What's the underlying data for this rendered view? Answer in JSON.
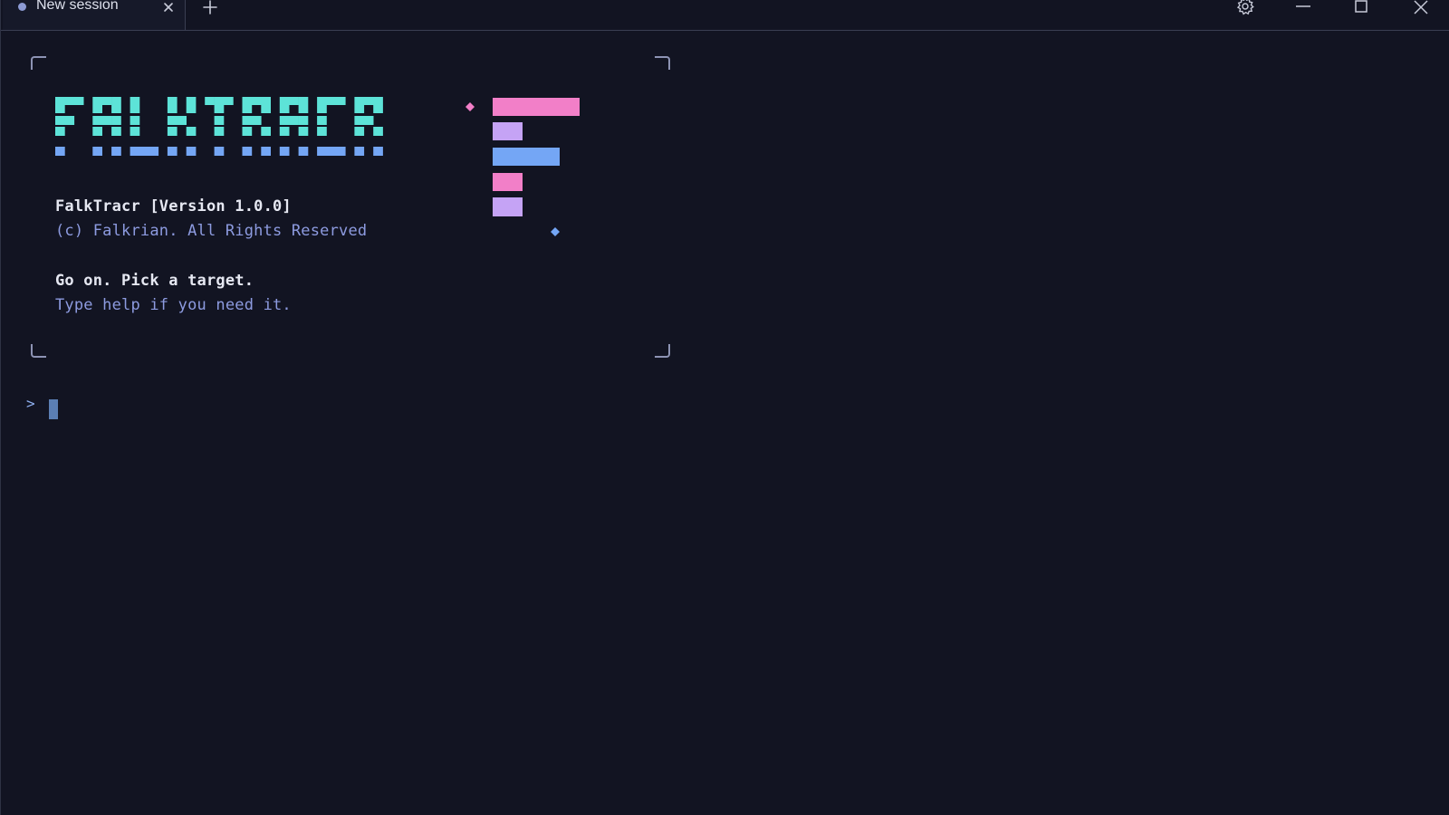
{
  "tab": {
    "label": "New session",
    "dot_icon": "status-dot-icon",
    "close_icon": "close-icon"
  },
  "titlebar": {
    "new_tab_icon": "plus-icon",
    "settings_icon": "gear-icon",
    "minimize_icon": "minimize-icon",
    "maximize_icon": "maximize-icon",
    "close_icon": "close-icon"
  },
  "banner": {
    "logo_text": "FALKTRACR",
    "version_line": "FalkTracr [Version 1.0.0]",
    "copyright_line": "(c) Falkrian. All Rights Reserved",
    "prompt_line": "Go on. Pick a target.",
    "hint_line": "Type help if you need it."
  },
  "input": {
    "prompt_symbol": ">",
    "value": ""
  },
  "colors": {
    "background": "#121422",
    "logo_teal": "#5de3d8",
    "logo_blue": "#74a6f5",
    "accent_pink": "#f27fc8",
    "accent_lavender": "#c5a3f5",
    "muted_text": "#8d9be0",
    "bright_text": "#e6e8f2"
  }
}
